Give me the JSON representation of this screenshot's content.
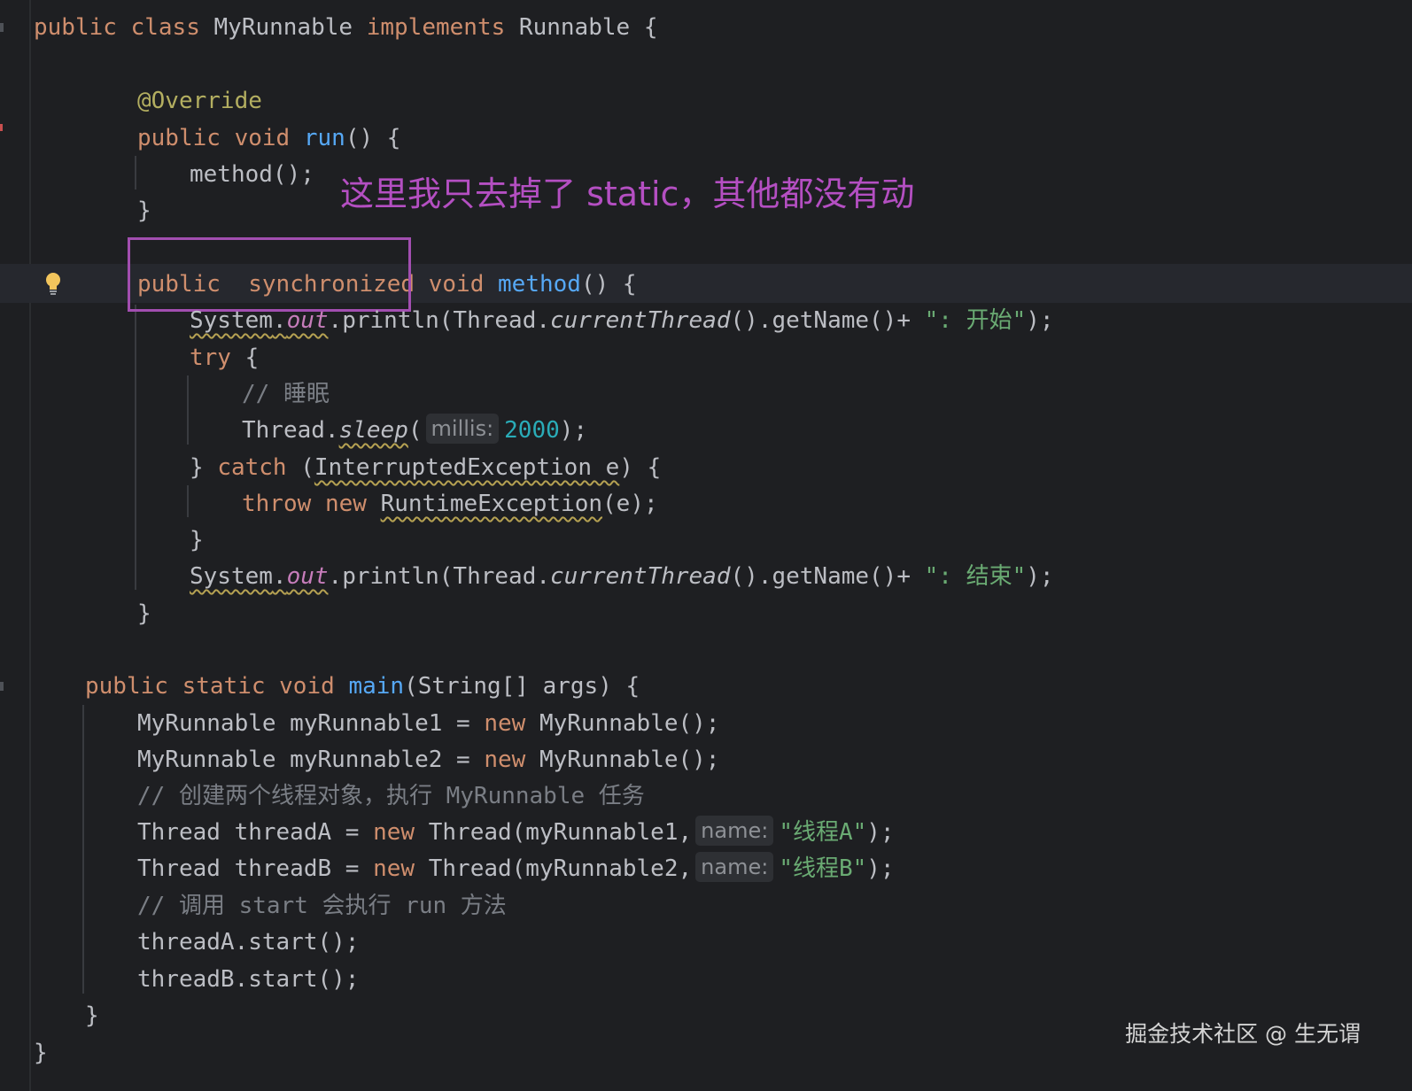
{
  "annotation": {
    "text": "这里我只去掉了 static，其他都没有动",
    "color": "#b44fc2"
  },
  "watermark": "掘金技术社区 @ 生无谓",
  "code": {
    "l1": {
      "k1": "public",
      "k2": "class",
      "name": "MyRunnable",
      "k3": "implements",
      "iface": "Runnable",
      "brace": "{"
    },
    "l2": {
      "ann": "@Override"
    },
    "l3": {
      "k1": "public",
      "k2": "void",
      "fn": "run",
      "rest": "() {"
    },
    "l4": {
      "text": "method();"
    },
    "l5": {
      "text": "}"
    },
    "l6": {
      "k1": "public",
      "k2": "synchronized",
      "k3": "void",
      "fn": "method",
      "rest": "() {"
    },
    "l7": {
      "sys": "System",
      "dot1": ".",
      "out": "out",
      "p1": ".println(Thread.",
      "ct": "currentThread",
      "p2": "().getName()+ ",
      "str": "\": 开始\"",
      "end": ");"
    },
    "l8": {
      "kw": "try",
      "rest": " {"
    },
    "l9": {
      "comment": "// 睡眠"
    },
    "l10": {
      "cls": "Thread.",
      "fn": "sleep",
      "open": "(",
      "hint": "millis:",
      "num": "2000",
      "end": ");"
    },
    "l11": {
      "pre": "} ",
      "kw": "catch",
      "open": " (",
      "ex": "InterruptedException e",
      "end": ") {"
    },
    "l12": {
      "k1": "throw",
      "k2": "new",
      "ex": "RuntimeException",
      "end": "(e);"
    },
    "l13": {
      "text": "}"
    },
    "l14": {
      "sys": "System",
      "dot1": ".",
      "out": "out",
      "p1": ".println(Thread.",
      "ct": "currentThread",
      "p2": "().getName()+ ",
      "str": "\": 结束\"",
      "end": ");"
    },
    "l15": {
      "text": "}"
    },
    "l16": {
      "k1": "public",
      "k2": "static",
      "k3": "void",
      "fn": "main",
      "rest": "(String[] args) {"
    },
    "l17": {
      "pre": "MyRunnable myRunnable1 = ",
      "kw": "new",
      "post": " MyRunnable();"
    },
    "l18": {
      "pre": "MyRunnable myRunnable2 = ",
      "kw": "new",
      "post": " MyRunnable();"
    },
    "l19": {
      "comment": "// 创建两个线程对象，执行 MyRunnable 任务"
    },
    "l20": {
      "pre": "Thread threadA = ",
      "kw": "new",
      "mid": " Thread(myRunnable1,",
      "hint": "name:",
      "str": "\"线程A\"",
      "end": ");"
    },
    "l21": {
      "pre": "Thread threadB = ",
      "kw": "new",
      "mid": " Thread(myRunnable2,",
      "hint": "name:",
      "str": "\"线程B\"",
      "end": ");"
    },
    "l22": {
      "comment": "// 调用 start 会执行 run 方法"
    },
    "l23": {
      "text": "threadA.start();"
    },
    "l24": {
      "text": "threadB.start();"
    },
    "l25": {
      "text": "}"
    },
    "l26": {
      "text": "}"
    }
  },
  "colors": {
    "background": "#1e1f22",
    "keyword": "#cf8e6d",
    "function": "#56a8f5",
    "string": "#6aab73",
    "comment": "#7a7e85",
    "annotation": "#b3ae60",
    "number": "#2aacb8",
    "static_field": "#c77dbb"
  }
}
